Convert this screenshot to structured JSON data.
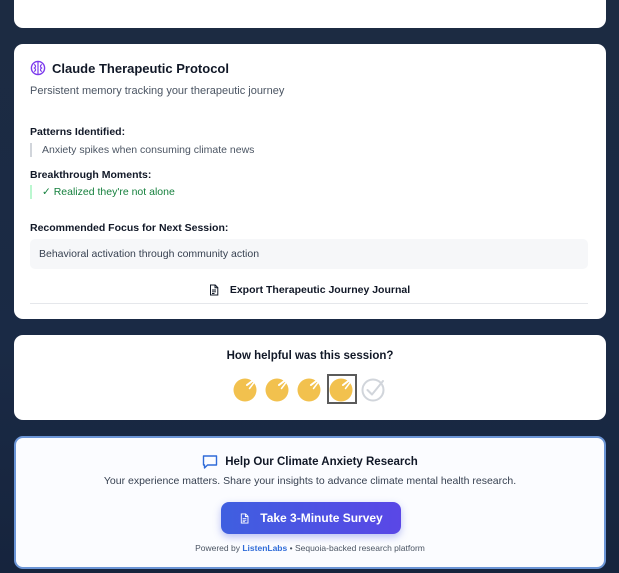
{
  "protocol": {
    "title": "Claude Therapeutic Protocol",
    "subtitle": "Persistent memory tracking your therapeutic journey",
    "patterns_label": "Patterns Identified:",
    "patterns_item": "Anxiety spikes when consuming climate news",
    "breakthrough_label": "Breakthrough Moments:",
    "breakthrough_item": "✓ Realized they're not alone",
    "focus_label": "Recommended Focus for Next Session:",
    "focus_value": "Behavioral activation through community action",
    "export_label": "Export Therapeutic Journey Journal",
    "accent_color": "#7c3aed"
  },
  "feedback": {
    "question": "How helpful was this session?",
    "rating_selected": 4,
    "rating_max": 5,
    "star_color": "#f2c14e"
  },
  "survey": {
    "title": "Help Our Climate Anxiety Research",
    "description": "Your experience matters. Share your insights to advance climate mental health research.",
    "button_label": "Take 3-Minute Survey",
    "powered_prefix": "Powered by",
    "powered_brand": "ListenLabs",
    "powered_suffix": "• Sequoia-backed research platform"
  }
}
